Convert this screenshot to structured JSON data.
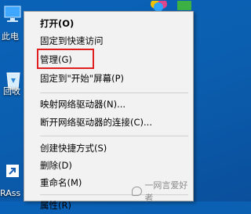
{
  "desktop": {
    "this_pc_label": "此电",
    "recycle_label": "回收",
    "ras_label": "RAss"
  },
  "menu": {
    "items": [
      {
        "label": "打开(O)"
      },
      {
        "label": "固定到快速访问"
      },
      {
        "label": "管理(G)"
      },
      {
        "label": "固定到\"开始\"屏幕(P)"
      },
      {
        "label": "映射网络驱动器(N)..."
      },
      {
        "label": "断开网络驱动器的连接(C)..."
      },
      {
        "label": "创建快捷方式(S)"
      },
      {
        "label": "删除(D)"
      },
      {
        "label": "重命名(M)"
      },
      {
        "label": "属性(R)"
      }
    ]
  },
  "watermark": {
    "text": "一网言爱好者"
  },
  "colors": {
    "highlight": "#e02020",
    "desktop": "#0a62b8"
  }
}
